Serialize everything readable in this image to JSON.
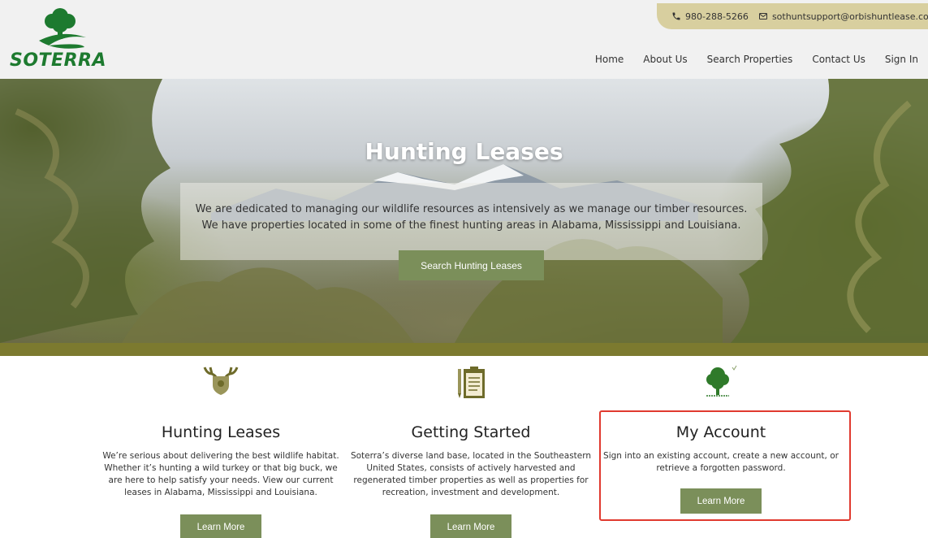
{
  "contact": {
    "phone": "980-288-5266",
    "email": "sothuntsupport@orbishuntlease.com"
  },
  "logo": {
    "text": "SOTERRA"
  },
  "nav": {
    "items": [
      {
        "label": "Home"
      },
      {
        "label": "About Us"
      },
      {
        "label": "Search Properties"
      },
      {
        "label": "Contact Us"
      },
      {
        "label": "Sign In"
      }
    ]
  },
  "hero": {
    "title": "Hunting Leases",
    "description": "We are dedicated to managing our wildlife resources as intensively as we manage our timber resources. We have properties located in some of the finest hunting areas in Alabama, Mississippi and Louisiana.",
    "button_label": "Search Hunting Leases"
  },
  "features": [
    {
      "icon": "antler-shield-icon",
      "title": "Hunting Leases",
      "description": "We’re serious about delivering the best wildlife habitat. Whether it’s hunting a wild turkey or that big buck, we are here to help satisfy your needs. View our current leases in Alabama, Mississippi and Louisiana.",
      "button_label": "Learn More"
    },
    {
      "icon": "clipboard-pencil-icon",
      "title": "Getting Started",
      "description": "Soterra’s diverse land base, located in the Southeastern United States, consists of actively harvested and regenerated timber properties as well as properties for recreation, investment and development.",
      "button_label": "Learn More"
    },
    {
      "icon": "tree-icon",
      "title": "My Account",
      "description": "Sign into an existing account, create a new account, or retrieve a forgotten password.",
      "button_label": "Learn More"
    }
  ],
  "colors": {
    "accent_green": "#7b8f5a",
    "band_olive": "#7c7a2f",
    "brand_green": "#1d7a2f",
    "contact_bar": "#d8cf9f",
    "highlight_red": "#e03a2f"
  }
}
